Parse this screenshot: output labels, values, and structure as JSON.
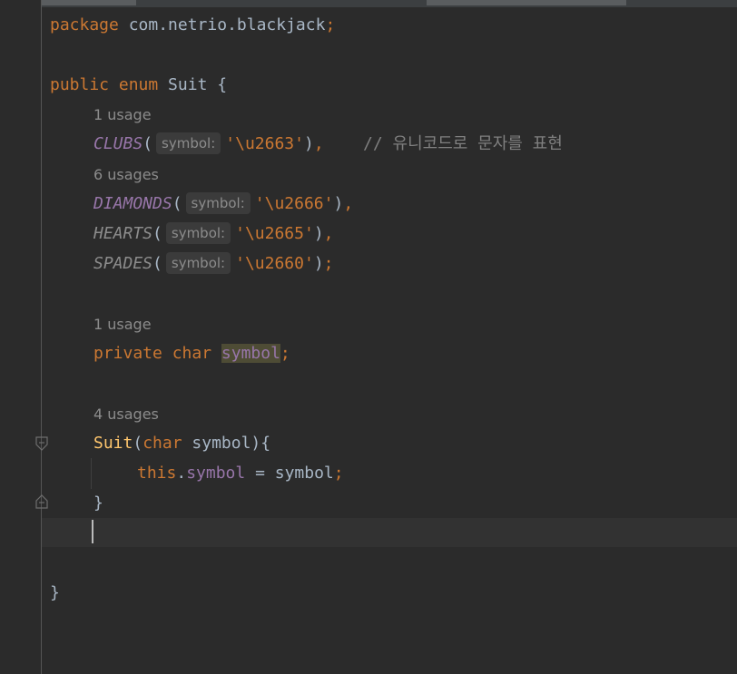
{
  "code": {
    "line_package_kw": "package",
    "line_package_name": " com.netrio.blackjack",
    "line_package_semi": ";",
    "line_enum_public": "public",
    "line_enum_enum": " enum",
    "line_enum_name": " Suit {",
    "usage_clubs": "1 usage",
    "clubs_name": "CLUBS",
    "clubs_open": "(",
    "inlay_symbol": "symbol:",
    "clubs_value": "'\\u2663'",
    "clubs_close": ")",
    "clubs_comma": ",",
    "clubs_comment": "    // 유니코드로 문자를 표현",
    "usage_diamonds": "6 usages",
    "diamonds_name": "DIAMONDS",
    "diamonds_value": "'\\u2666'",
    "hearts_name": "HEARTS",
    "hearts_value": "'\\u2665'",
    "spades_name": "SPADES",
    "spades_value": "'\\u2660'",
    "spades_end": ";",
    "usage_field": "1 usage",
    "field_private": "private",
    "field_char": " char",
    "field_name": "symbol",
    "field_semi": ";",
    "usage_ctor": "4 usages",
    "ctor_name": "Suit",
    "ctor_paren": "(",
    "ctor_char": "char",
    "ctor_param": " symbol){",
    "body_this": "this",
    "body_dot": ".",
    "body_field": "symbol",
    "body_assign": " = symbol",
    "body_semi": ";",
    "ctor_close": "}",
    "enum_close": "}"
  },
  "colors": {
    "background": "#2b2b2b",
    "keyword": "#cc7832",
    "enum_constant": "#9876aa",
    "string": "#6a8759",
    "comment": "#808080",
    "text": "#a9b7c6"
  }
}
